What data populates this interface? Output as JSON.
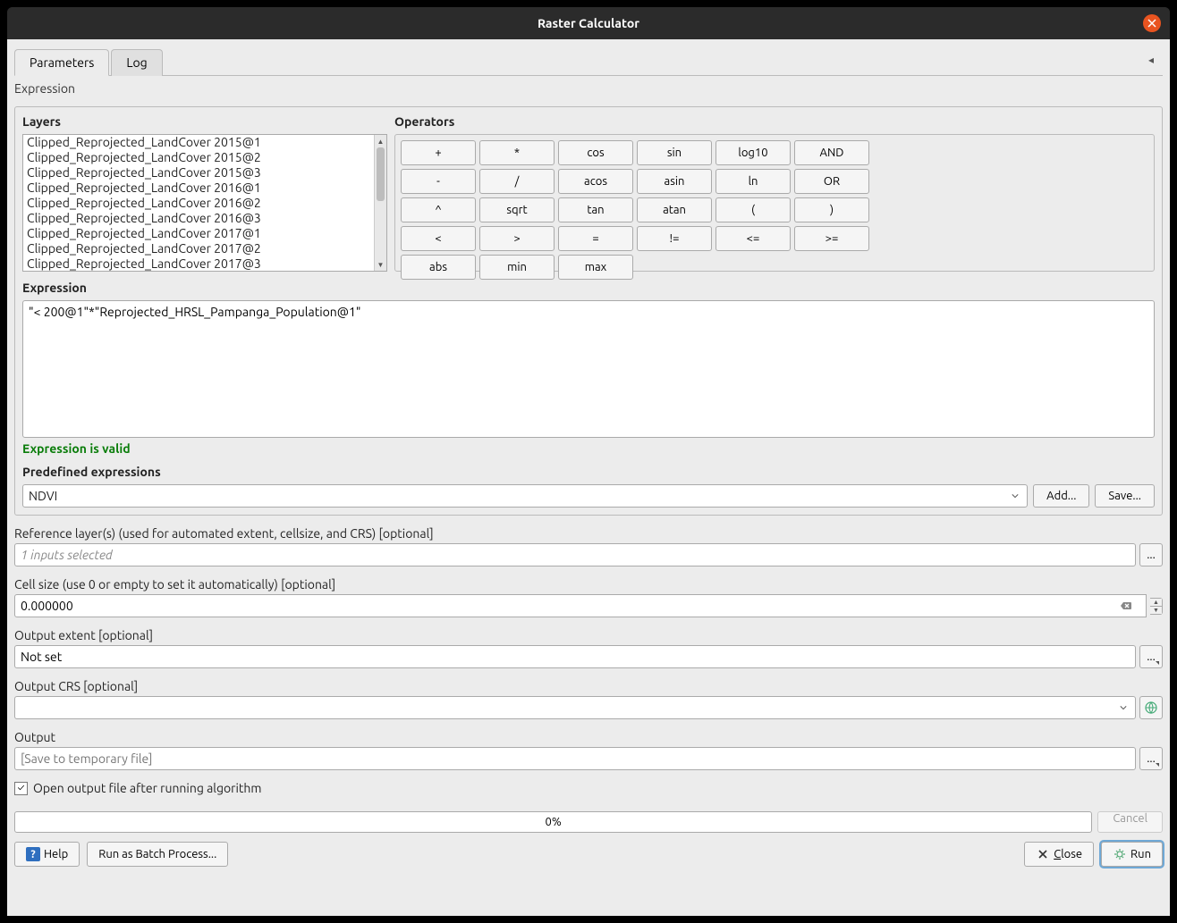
{
  "title": "Raster Calculator",
  "tabs": {
    "parameters": "Parameters",
    "log": "Log"
  },
  "expression_heading": "Expression",
  "layers": {
    "title": "Layers",
    "items": [
      "Clipped_Reprojected_LandCover 2015@1",
      "Clipped_Reprojected_LandCover 2015@2",
      "Clipped_Reprojected_LandCover 2015@3",
      "Clipped_Reprojected_LandCover 2016@1",
      "Clipped_Reprojected_LandCover 2016@2",
      "Clipped_Reprojected_LandCover 2016@3",
      "Clipped_Reprojected_LandCover 2017@1",
      "Clipped_Reprojected_LandCover 2017@2",
      "Clipped_Reprojected_LandCover 2017@3"
    ]
  },
  "operators": {
    "title": "Operators",
    "grid": [
      [
        "+",
        "*",
        "cos",
        "sin",
        "log10",
        "AND"
      ],
      [
        "-",
        "/",
        "acos",
        "asin",
        "ln",
        "OR"
      ],
      [
        "^",
        "sqrt",
        "tan",
        "atan",
        "(",
        ")"
      ],
      [
        "<",
        ">",
        "=",
        "!=",
        "<=",
        ">="
      ],
      [
        "abs",
        "min",
        "max"
      ]
    ]
  },
  "expression_section": {
    "label": "Expression",
    "value": "\"< 200@1\"*\"Reprojected_HRSL_Pampanga_Population@1\"",
    "valid_msg": "Expression is valid"
  },
  "predef": {
    "label": "Predefined expressions",
    "value": "NDVI",
    "add": "Add...",
    "save": "Save..."
  },
  "ref_layer": {
    "label": "Reference layer(s) (used for automated extent, cellsize, and CRS) [optional]",
    "value": "1 inputs selected",
    "dots": "..."
  },
  "cell_size": {
    "label": "Cell size (use 0 or empty to set it automatically) [optional]",
    "value": "0.000000"
  },
  "output_extent": {
    "label": "Output extent [optional]",
    "value": "Not set",
    "dots": "..."
  },
  "output_crs": {
    "label": "Output CRS [optional]",
    "value": ""
  },
  "output": {
    "label": "Output",
    "placeholder": "[Save to temporary file]",
    "dots": "..."
  },
  "open_output": {
    "label": "Open output file after running algorithm",
    "checked": true
  },
  "progress": {
    "text": "0%",
    "cancel": "Cancel"
  },
  "bottom": {
    "help": "Help",
    "batch": "Run as Batch Process...",
    "close": "Close",
    "run": "Run"
  }
}
